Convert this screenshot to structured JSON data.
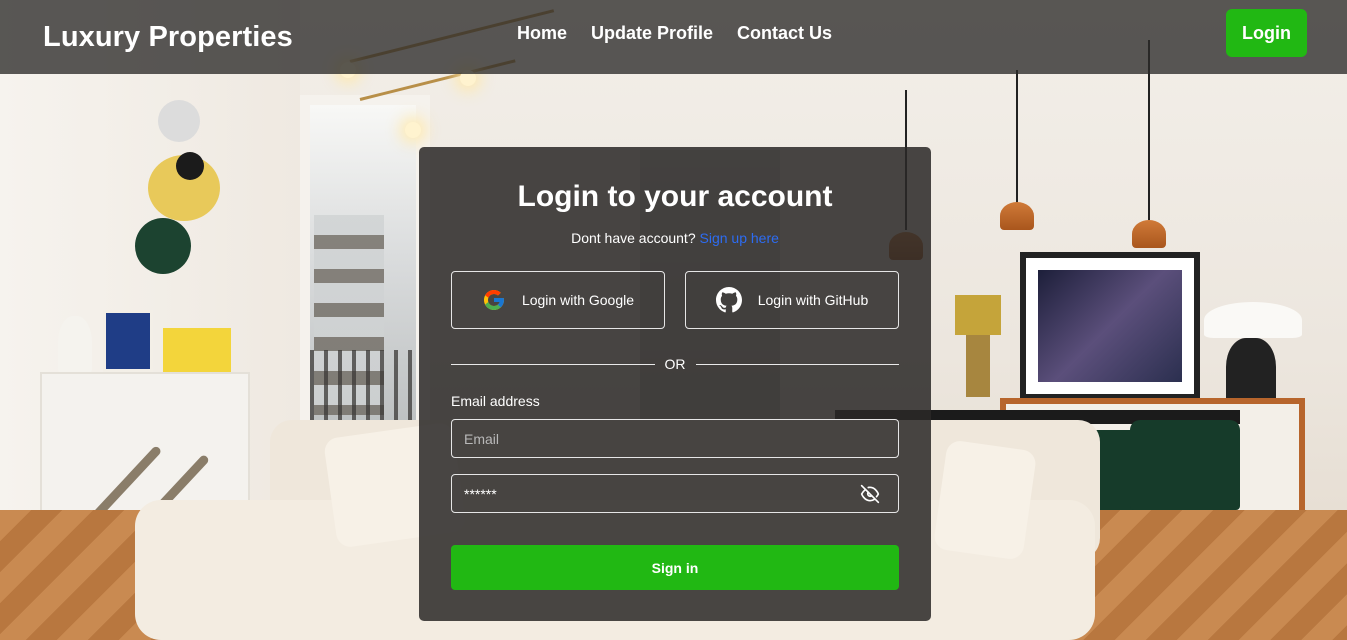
{
  "navbar": {
    "brand": "Luxury Properties",
    "links": [
      "Home",
      "Update Profile",
      "Contact Us"
    ],
    "login_label": "Login"
  },
  "login_card": {
    "title": "Login to your account",
    "signup_prompt": "Dont have account?",
    "signup_link": "Sign up here",
    "google_label": "Login with Google",
    "github_label": "Login with GitHub",
    "divider_text": "OR",
    "email_label": "Email address",
    "email_placeholder": "Email",
    "password_value": "******",
    "signin_label": "Sign in"
  },
  "colors": {
    "accent_green": "#21b813",
    "link_blue": "#2d6cf2"
  },
  "icons": {
    "google": "google-icon",
    "github": "github-icon",
    "password_toggle": "eye-off-icon"
  }
}
